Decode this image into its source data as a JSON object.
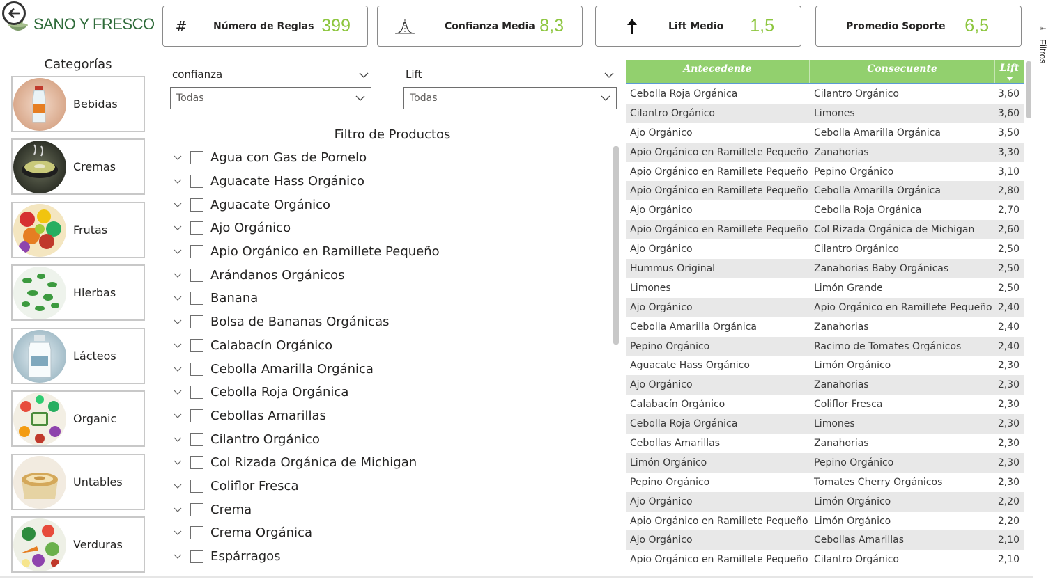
{
  "brand": {
    "name": "SANO Y FRESCO",
    "accent": "#8dc63f",
    "header_green": "#92d06e"
  },
  "kpis": [
    {
      "icon": "hash-icon",
      "label": "Número de Reglas",
      "value": "399"
    },
    {
      "icon": "distribution-icon",
      "label": "Confianza Media",
      "value": "8,3"
    },
    {
      "icon": "arrow-up-icon",
      "label": "Lift Medio",
      "value": "1,5"
    },
    {
      "icon": "",
      "label": "Promedio Soporte",
      "value": "6,5"
    }
  ],
  "categories": {
    "title": "Categorías",
    "items": [
      {
        "label": "Bebidas",
        "image": "water-bottle"
      },
      {
        "label": "Cremas",
        "image": "soup-bowl"
      },
      {
        "label": "Frutas",
        "image": "fruit-mix"
      },
      {
        "label": "Hierbas",
        "image": "herb-leaves"
      },
      {
        "label": "Lácteos",
        "image": "milk-jar"
      },
      {
        "label": "Organic",
        "image": "organic-produce"
      },
      {
        "label": "Untables",
        "image": "spread-tub"
      },
      {
        "label": "Verduras",
        "image": "vegetable-mix"
      }
    ]
  },
  "slicers": {
    "confianza": {
      "title": "confianza",
      "value": "Todas"
    },
    "lift": {
      "title": "Lift",
      "value": "Todas"
    }
  },
  "product_filter": {
    "title": "Filtro de Productos",
    "items": [
      "Agua con Gas de Pomelo",
      "Aguacate Hass Orgánico",
      "Aguacate Orgánico",
      "Ajo Orgánico",
      "Apio Orgánico en Ramillete Pequeño",
      "Arándanos Orgánicos",
      "Banana",
      "Bolsa de Bananas Orgánicas",
      "Calabacín Orgánico",
      "Cebolla Amarilla Orgánica",
      "Cebolla Roja Orgánica",
      "Cebollas Amarillas",
      "Cilantro Orgánico",
      "Col Rizada Orgánica de Michigan",
      "Coliflor Fresca",
      "Crema",
      "Crema Orgánica",
      "Espárragos"
    ]
  },
  "rules_table": {
    "headers": [
      "Antecedente",
      "Consecuente",
      "Lift"
    ],
    "rows": [
      [
        "Cebolla Roja Orgánica",
        "Cilantro Orgánico",
        "3,60"
      ],
      [
        "Cilantro Orgánico",
        "Limones",
        "3,60"
      ],
      [
        "Ajo Orgánico",
        "Cebolla Amarilla Orgánica",
        "3,50"
      ],
      [
        "Apio Orgánico en Ramillete Pequeño",
        "Zanahorias",
        "3,30"
      ],
      [
        "Apio Orgánico en Ramillete Pequeño",
        "Pepino Orgánico",
        "3,10"
      ],
      [
        "Apio Orgánico en Ramillete Pequeño",
        "Cebolla Amarilla Orgánica",
        "2,80"
      ],
      [
        "Ajo Orgánico",
        "Cebolla Roja Orgánica",
        "2,70"
      ],
      [
        "Apio Orgánico en Ramillete Pequeño",
        "Col Rizada Orgánica de Michigan",
        "2,60"
      ],
      [
        "Ajo Orgánico",
        "Cilantro Orgánico",
        "2,50"
      ],
      [
        "Hummus Original",
        "Zanahorias Baby Orgánicas",
        "2,50"
      ],
      [
        "Limones",
        "Limón Grande",
        "2,50"
      ],
      [
        "Ajo Orgánico",
        "Apio Orgánico en Ramillete Pequeño",
        "2,40"
      ],
      [
        "Cebolla Amarilla Orgánica",
        "Zanahorias",
        "2,40"
      ],
      [
        "Pepino Orgánico",
        "Racimo de Tomates Orgánicos",
        "2,40"
      ],
      [
        "Aguacate Hass Orgánico",
        "Limón Orgánico",
        "2,30"
      ],
      [
        "Ajo Orgánico",
        "Zanahorias",
        "2,30"
      ],
      [
        "Calabacín Orgánico",
        "Coliflor Fresca",
        "2,30"
      ],
      [
        "Cebolla Roja Orgánica",
        "Limones",
        "2,30"
      ],
      [
        "Cebollas Amarillas",
        "Zanahorias",
        "2,30"
      ],
      [
        "Limón Orgánico",
        "Pepino Orgánico",
        "2,30"
      ],
      [
        "Pepino Orgánico",
        "Tomates Cherry Orgánicos",
        "2,30"
      ],
      [
        "Ajo Orgánico",
        "Limón Orgánico",
        "2,20"
      ],
      [
        "Apio Orgánico en Ramillete Pequeño",
        "Limón Orgánico",
        "2,20"
      ],
      [
        "Ajo Orgánico",
        "Cebollas Amarillas",
        "2,10"
      ],
      [
        "Apio Orgánico en Ramillete Pequeño",
        "Cilantro Orgánico",
        "2,10"
      ]
    ]
  },
  "filters_pane": {
    "label": "Filtros"
  }
}
